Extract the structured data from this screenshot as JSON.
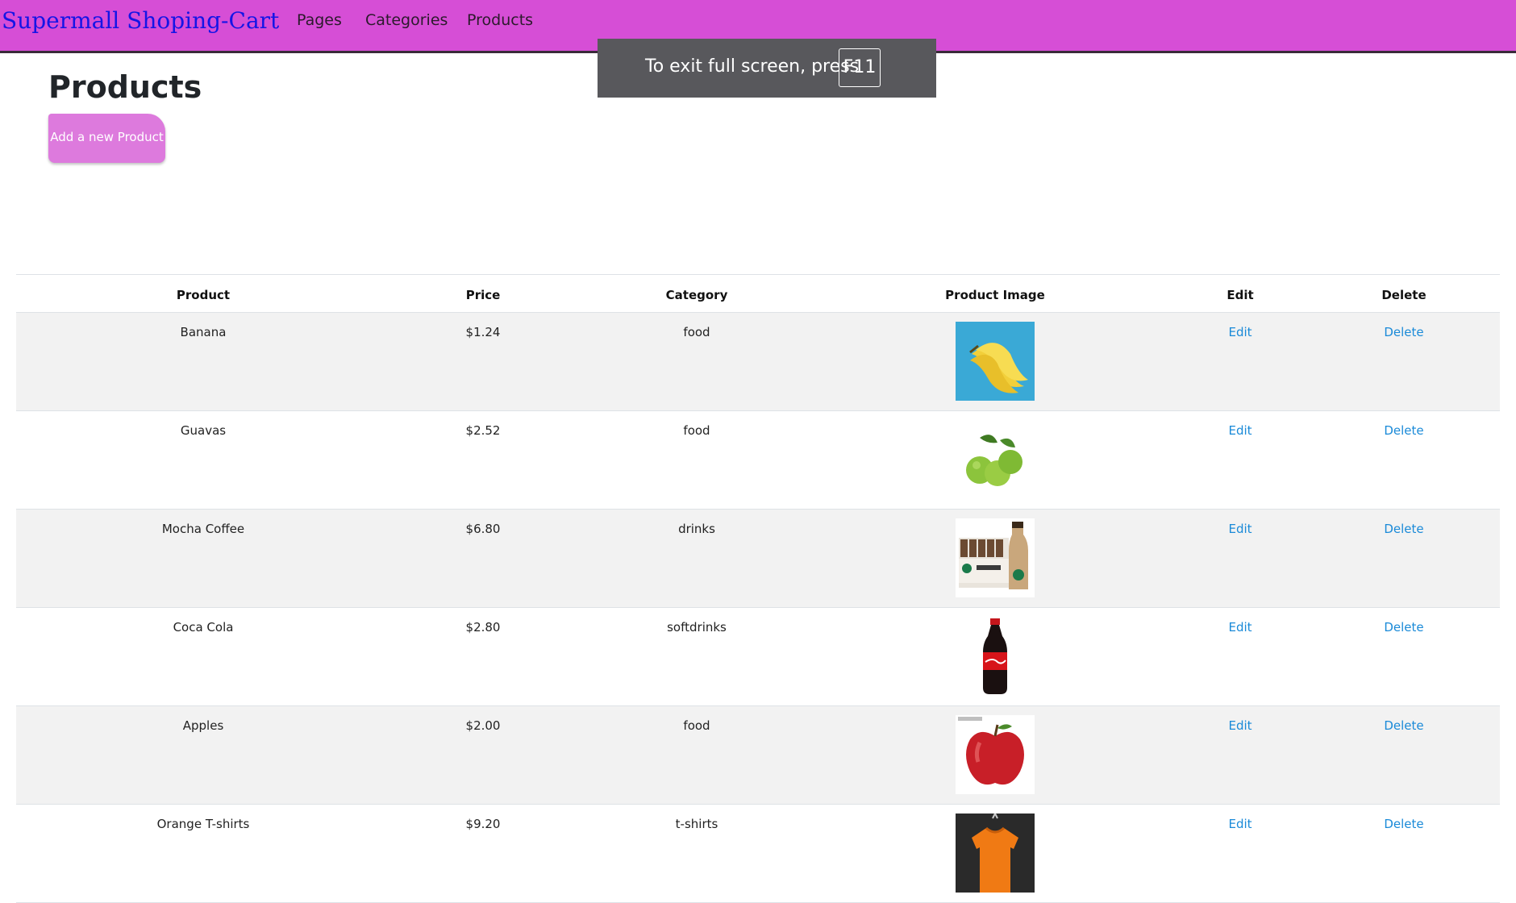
{
  "navbar": {
    "brand": "Supermall Shoping-Cart",
    "links": [
      "Pages",
      "Categories",
      "Products"
    ]
  },
  "fullscreen_toast": {
    "text": "To exit full screen, press",
    "key": "F11"
  },
  "main": {
    "title": "Products",
    "add_button": "Add a new Product"
  },
  "table": {
    "headers": [
      "Product",
      "Price",
      "Category",
      "Product Image",
      "Edit",
      "Delete"
    ],
    "rows": [
      {
        "product": "Banana",
        "price": "$1.24",
        "category": "food",
        "image": "banana-image",
        "edit": "Edit",
        "delete": "Delete"
      },
      {
        "product": "Guavas",
        "price": "$2.52",
        "category": "food",
        "image": "guavas-image",
        "edit": "Edit",
        "delete": "Delete"
      },
      {
        "product": "Mocha Coffee",
        "price": "$6.80",
        "category": "drinks",
        "image": "mocha-coffee-image",
        "edit": "Edit",
        "delete": "Delete"
      },
      {
        "product": "Coca Cola",
        "price": "$2.80",
        "category": "softdrinks",
        "image": "coca-cola-image",
        "edit": "Edit",
        "delete": "Delete"
      },
      {
        "product": "Apples",
        "price": "$2.00",
        "category": "food",
        "image": "apples-image",
        "edit": "Edit",
        "delete": "Delete"
      },
      {
        "product": "Orange T-shirts",
        "price": "$9.20",
        "category": "t-shirts",
        "image": "orange-tshirt-image",
        "edit": "Edit",
        "delete": "Delete"
      }
    ]
  },
  "colors": {
    "navbar_bg": "#d64ed6",
    "brand_text": "#1515e6",
    "add_button_bg": "#dd7add",
    "link": "#1a8ad8",
    "striped_row": "#f2f2f2",
    "toast_bg": "#58585c"
  }
}
